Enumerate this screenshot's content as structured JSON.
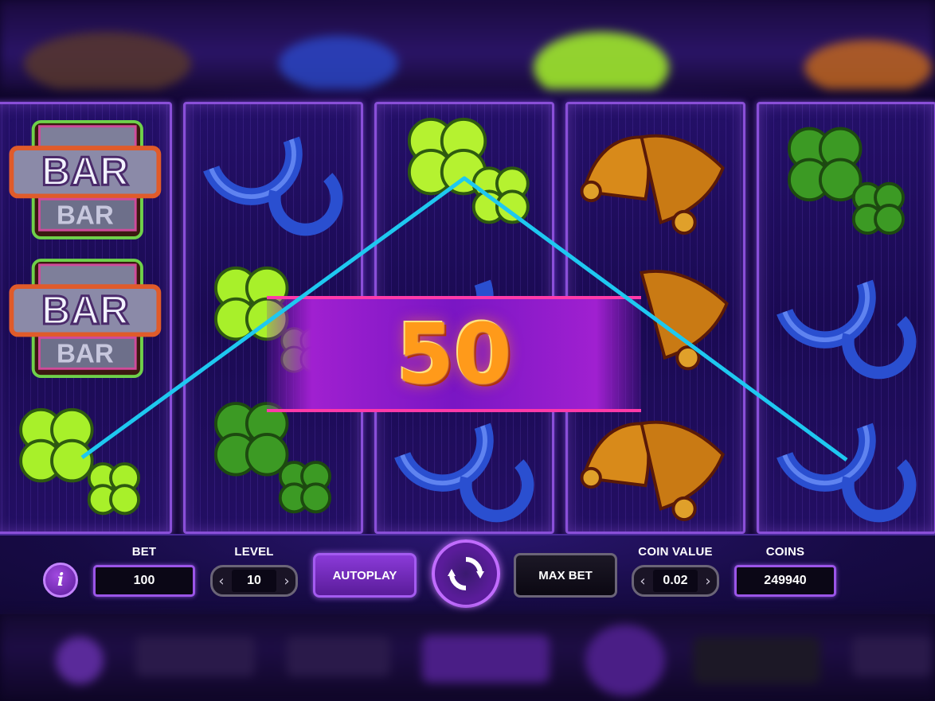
{
  "game": {
    "win_amount": "50"
  },
  "panel": {
    "info_button": "i",
    "bet_label": "BET",
    "bet_value": "100",
    "level_label": "LEVEL",
    "level_value": "10",
    "autoplay_label": "AUTOPLAY",
    "max_bet_label": "MAX BET",
    "coin_value_label": "COIN VALUE",
    "coin_value": "0.02",
    "coins_label": "COINS",
    "coins_value": "249940"
  },
  "reels": [
    [
      "bar",
      "bar",
      "clover"
    ],
    [
      "horseshoe",
      "clover",
      "clover"
    ],
    [
      "clover",
      "horseshoe",
      "horseshoe"
    ],
    [
      "bell",
      "bell",
      "bell"
    ],
    [
      "clover",
      "horseshoe",
      "horseshoe"
    ]
  ],
  "colors": {
    "reel_border": "#8a4fd8",
    "payline": "#1ec8f0",
    "win_banner": "#b51fd8",
    "win_text": "#ff9a1a"
  }
}
